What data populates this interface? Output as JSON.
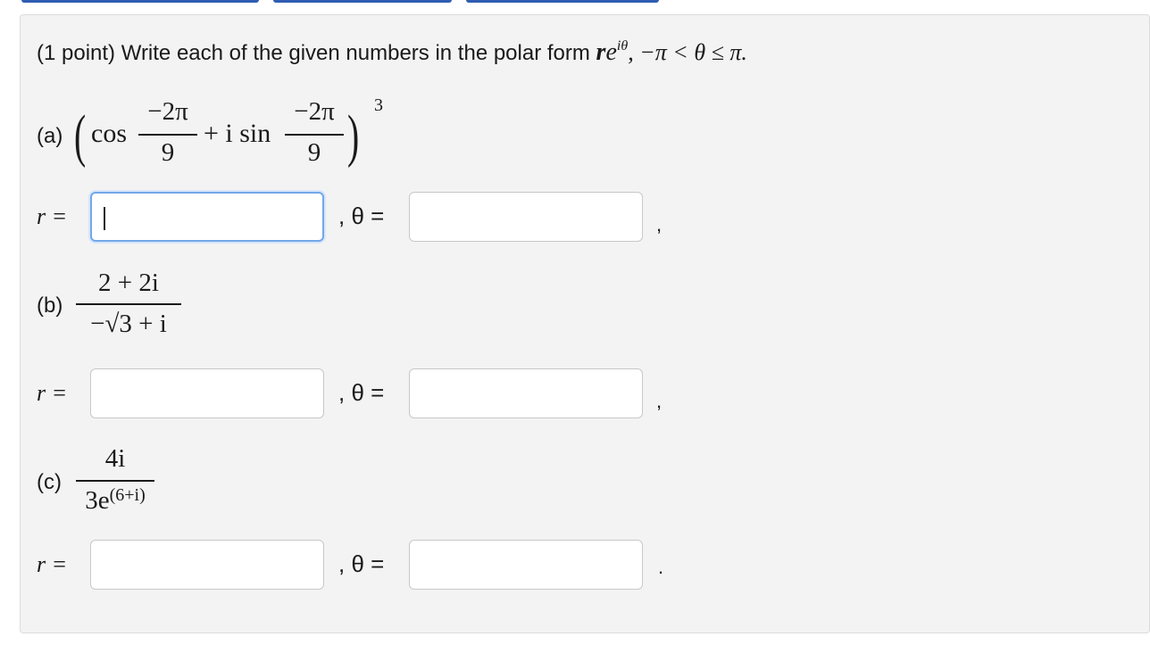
{
  "problem": {
    "points": "(1 point)",
    "instruction": "Write each of the given numbers in the polar form",
    "polar_r": "r",
    "polar_e": "e",
    "polar_exp": "iθ",
    "range": ", −π < θ ≤ π."
  },
  "parts": [
    {
      "label": "(a)",
      "cos": "cos",
      "angle_num": "−2π",
      "angle_den": "9",
      "plus_i_sin": "+ i sin",
      "power": "3",
      "r_label": "r =",
      "theta_label": ", θ =",
      "r_value": "",
      "theta_value": "",
      "trailing": ","
    },
    {
      "label": "(b)",
      "numerator": "2 + 2i",
      "denominator": "−√3 + i",
      "r_label": "r =",
      "theta_label": ", θ =",
      "r_value": "",
      "theta_value": "",
      "trailing": ","
    },
    {
      "label": "(c)",
      "numerator": "4i",
      "denominator_base": "3e",
      "denominator_exp": "(6+i)",
      "r_label": "r =",
      "theta_label": ", θ =",
      "r_value": "",
      "theta_value": "",
      "trailing": "."
    }
  ]
}
